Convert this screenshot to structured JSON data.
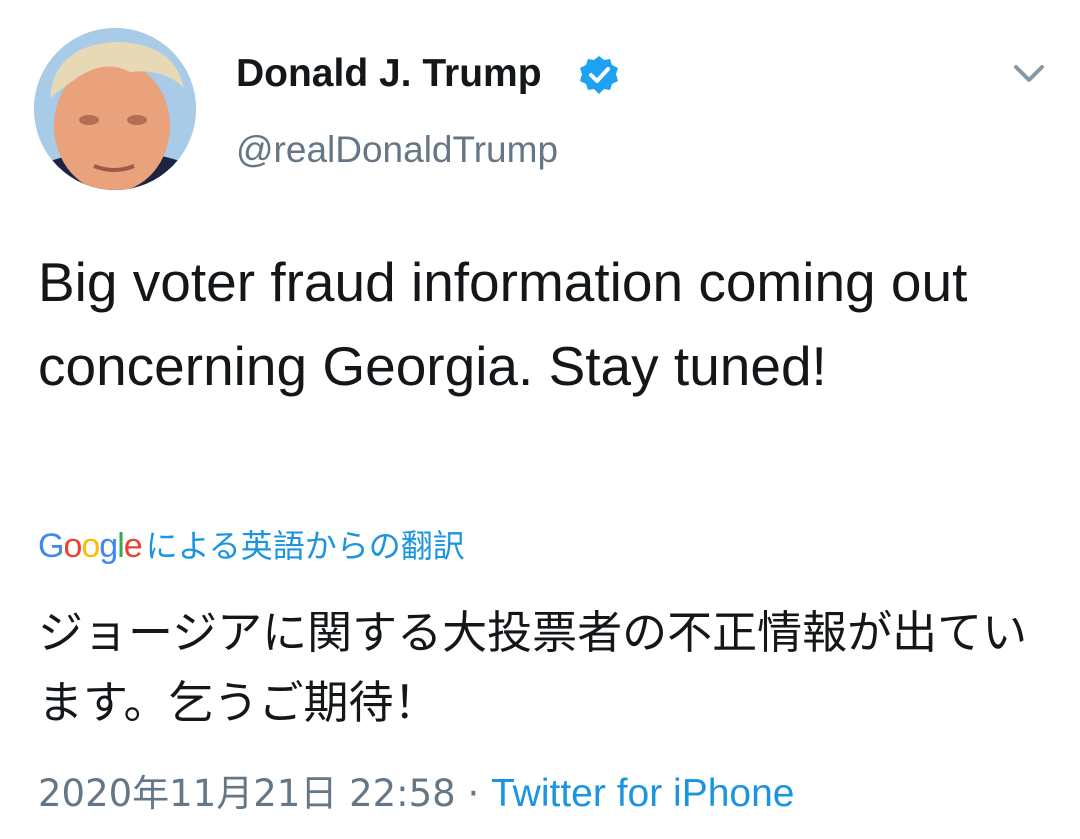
{
  "tweet": {
    "author": {
      "display_name": "Donald J. Trump",
      "handle": "@realDonaldTrump",
      "verified": true
    },
    "text": "Big voter fraud information coming out concerning Georgia. Stay tuned!",
    "translation": {
      "provider_letters": [
        "G",
        "o",
        "o",
        "g",
        "l",
        "e"
      ],
      "label": "による英語からの翻訳",
      "text": "ジョージアに関する大投票者の不正情報が出ています。乞うご期待！"
    },
    "meta": {
      "date": "2020年11月21日 22:58",
      "separator": "·",
      "source": "Twitter for iPhone"
    }
  },
  "icons": {
    "verified": "verified-badge-icon",
    "caret": "chevron-down-icon"
  },
  "colors": {
    "text": "#14171a",
    "secondary": "#657786",
    "link": "#1b95e0",
    "verified": "#1da1f2"
  }
}
